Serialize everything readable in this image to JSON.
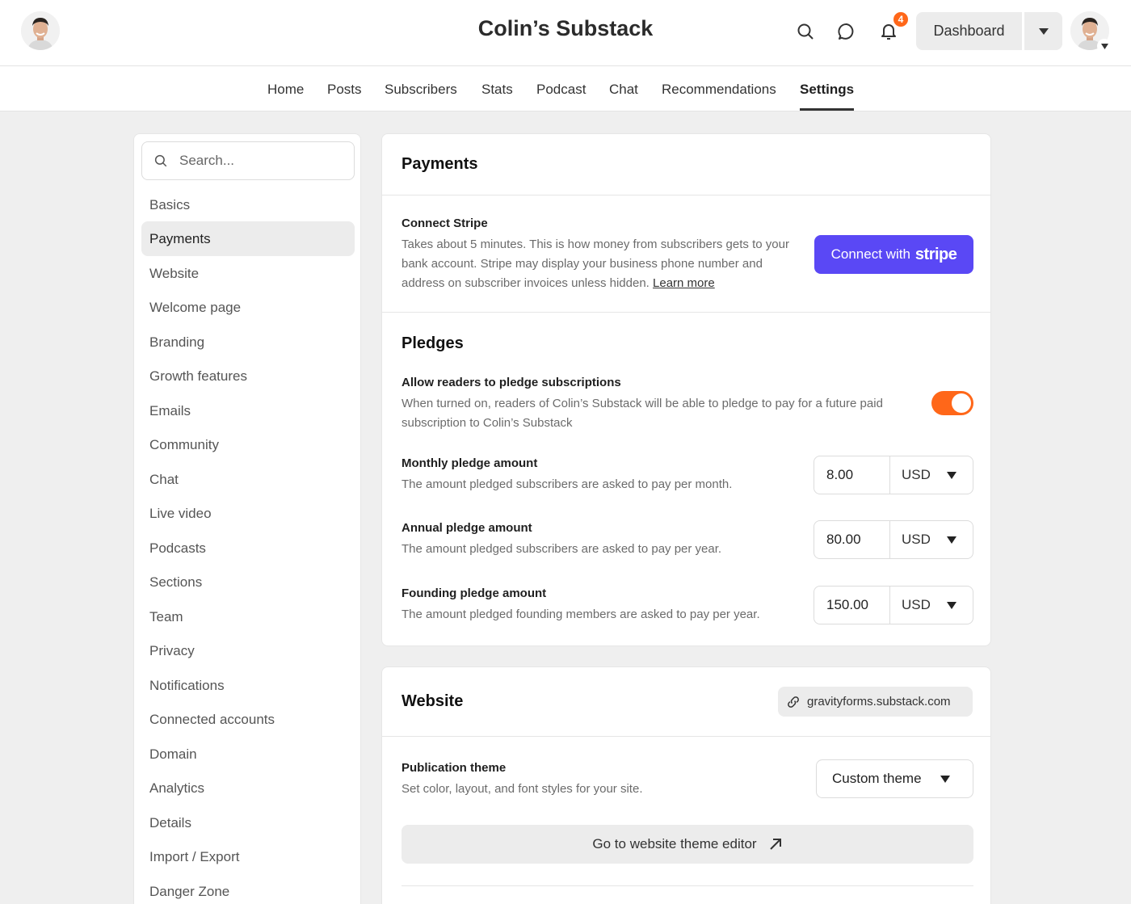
{
  "header": {
    "site_title": "Colin’s Substack",
    "notification_count": "4",
    "dashboard_label": "Dashboard",
    "icons": [
      "search-icon",
      "chat-bubble-icon",
      "bell-icon",
      "chevron-down-icon"
    ]
  },
  "nav": {
    "tabs": [
      {
        "label": "Home"
      },
      {
        "label": "Posts"
      },
      {
        "label": "Subscribers"
      },
      {
        "label": "Stats"
      },
      {
        "label": "Podcast"
      },
      {
        "label": "Chat"
      },
      {
        "label": "Recommendations"
      },
      {
        "label": "Settings"
      }
    ],
    "active_tab": "Settings"
  },
  "sidebar": {
    "search_placeholder": "Search...",
    "items": [
      {
        "label": "Basics"
      },
      {
        "label": "Payments"
      },
      {
        "label": "Website"
      },
      {
        "label": "Welcome page"
      },
      {
        "label": "Branding"
      },
      {
        "label": "Growth features"
      },
      {
        "label": "Emails"
      },
      {
        "label": "Community"
      },
      {
        "label": "Chat"
      },
      {
        "label": "Live video"
      },
      {
        "label": "Podcasts"
      },
      {
        "label": "Sections"
      },
      {
        "label": "Team"
      },
      {
        "label": "Privacy"
      },
      {
        "label": "Notifications"
      },
      {
        "label": "Connected accounts"
      },
      {
        "label": "Domain"
      },
      {
        "label": "Analytics"
      },
      {
        "label": "Details"
      },
      {
        "label": "Import / Export"
      },
      {
        "label": "Danger Zone"
      }
    ],
    "active_item": "Payments"
  },
  "payments": {
    "title": "Payments",
    "stripe": {
      "title": "Connect Stripe",
      "description": "Takes about 5 minutes. This is how money from subscribers gets to your bank account. Stripe may display your business phone number and address on subscriber invoices unless hidden.",
      "learn_more": "Learn more",
      "button_prefix": "Connect with",
      "button_brand": "stripe"
    },
    "pledges": {
      "title": "Pledges",
      "allow_title": "Allow readers to pledge subscriptions",
      "allow_description": "When turned on, readers of Colin’s Substack will be able to pledge to pay for a future paid subscription to Colin’s Substack",
      "allow_enabled": true,
      "monthly": {
        "title": "Monthly pledge amount",
        "description": "The amount pledged subscribers are asked to pay per month.",
        "value": "8.00",
        "currency": "USD"
      },
      "annual": {
        "title": "Annual pledge amount",
        "description": "The amount pledged subscribers are asked to pay per year.",
        "value": "80.00",
        "currency": "USD"
      },
      "founding": {
        "title": "Founding pledge amount",
        "description": "The amount pledged founding members are asked to pay per year.",
        "value": "150.00",
        "currency": "USD"
      }
    }
  },
  "website": {
    "title": "Website",
    "url": "gravityforms.substack.com",
    "theme_title": "Publication theme",
    "theme_description": "Set color, layout, and font styles for your site.",
    "theme_value": "Custom theme",
    "editor_button": "Go to website theme editor"
  },
  "colors": {
    "accent": "#ff6719",
    "stripe": "#5a48f5"
  }
}
